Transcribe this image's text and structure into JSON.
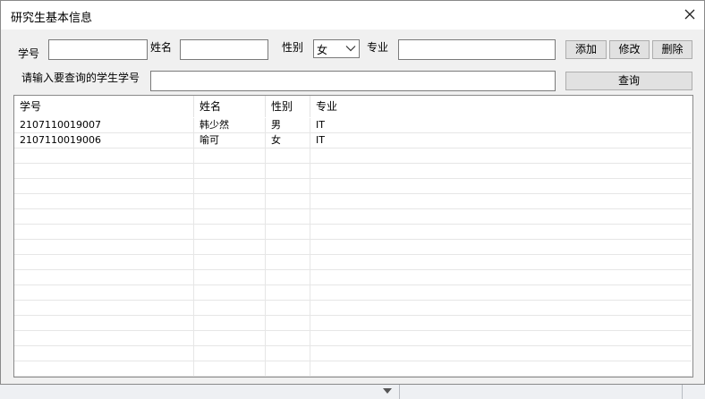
{
  "window": {
    "title": "研究生基本信息"
  },
  "form": {
    "student_id_label": "学号",
    "student_id_value": "",
    "name_label": "姓名",
    "name_value": "",
    "gender_label": "性别",
    "gender_selected": "女",
    "major_label": "专业",
    "major_value": "",
    "add_label": "添加",
    "edit_label": "修改",
    "delete_label": "删除"
  },
  "query": {
    "prompt_label": "请输入要查询的学生学号",
    "value": "",
    "button_label": "查询"
  },
  "table": {
    "columns": [
      "学号",
      "姓名",
      "性别",
      "专业"
    ],
    "rows": [
      [
        "2107110019007",
        "韩少然",
        "男",
        "IT"
      ],
      [
        "2107110019006",
        "喻可",
        "女",
        "IT"
      ]
    ]
  }
}
